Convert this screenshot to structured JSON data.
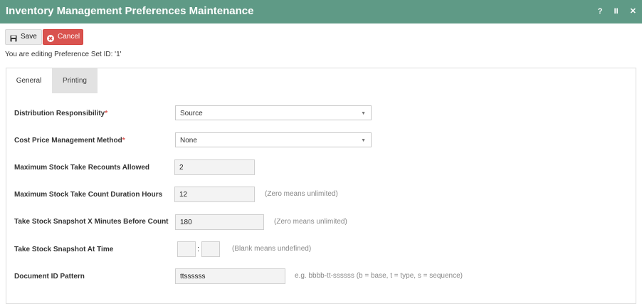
{
  "window": {
    "title": "Inventory Management Preferences Maintenance",
    "help": "?",
    "pause": "II",
    "close": "✕"
  },
  "toolbar": {
    "save_label": "Save",
    "cancel_label": "Cancel"
  },
  "editing_text": "You are editing Preference Set ID: '1'",
  "tabs": [
    {
      "label": "General",
      "active": true
    },
    {
      "label": "Printing",
      "active": false
    }
  ],
  "form": {
    "required_mark": "*",
    "distribution": {
      "label": "Distribution Responsibility",
      "value": "Source"
    },
    "cost_method": {
      "label": "Cost Price Management Method",
      "value": "None"
    },
    "max_recounts": {
      "label": "Maximum Stock Take Recounts Allowed",
      "value": "2"
    },
    "max_duration": {
      "label": "Maximum Stock Take Count Duration Hours",
      "value": "12",
      "hint": "(Zero means unlimited)"
    },
    "snapshot_minutes": {
      "label": "Take Stock Snapshot X Minutes Before Count",
      "value": "180",
      "hint": "(Zero means unlimited)"
    },
    "snapshot_time": {
      "label": "Take Stock Snapshot At Time",
      "hours": "",
      "minutes": "",
      "separator": ":",
      "hint": "(Blank means undefined)"
    },
    "doc_pattern": {
      "label": "Document ID Pattern",
      "value": "ttssssss",
      "hint": "e.g. bbbb-tt-ssssss (b = base, t = type, s = sequence)"
    }
  },
  "colors": {
    "titlebar": "#5f9a86",
    "cancel": "#d9534f",
    "required": "#d9534f"
  },
  "icons": {
    "save": "floppy-disk-icon",
    "cancel": "cancel-circle-icon",
    "dropdown": "caret-down-icon"
  }
}
